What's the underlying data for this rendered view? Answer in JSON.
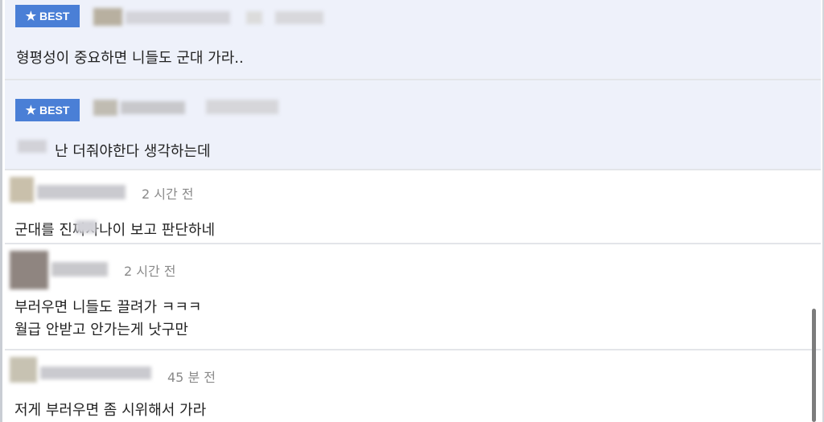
{
  "comments": [
    {
      "badge": "BEST",
      "text": "형평성이 중요하면 니들도 군대 가라.."
    },
    {
      "badge": "BEST",
      "text": "난 더줘야한다 생각하는데"
    },
    {
      "time": "2 시간 전",
      "text": "군대를 진짜사나이 보고 판단하네"
    },
    {
      "time": "2 시간 전",
      "line1": "부러우면 니들도 끌려가 ㅋㅋㅋ",
      "line2": "월급 안받고 안가는게 낫구만"
    },
    {
      "time": "45 분 전",
      "text": "저게 부러우면 좀 시위해서 가라"
    }
  ],
  "icons": {
    "badge_star": "star-icon"
  },
  "colors": {
    "best_bg": "#eef1fa",
    "badge_bg": "#4a7fd6",
    "time": "#8a8a8a"
  }
}
